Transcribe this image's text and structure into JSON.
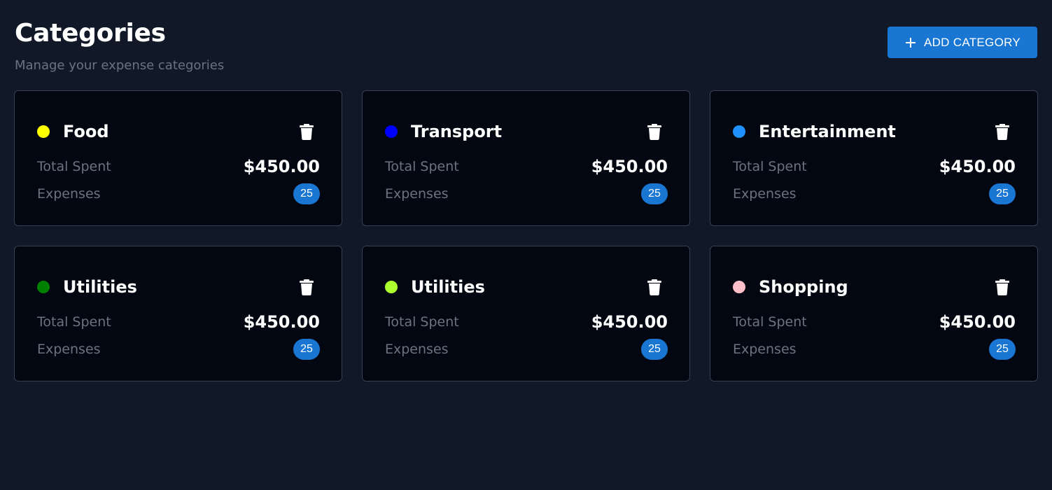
{
  "header": {
    "title": "Categories",
    "subtitle": "Manage your expense categories"
  },
  "toolbar": {
    "add_label": "ADD CATEGORY",
    "add_icon": "plus-icon",
    "accent_color": "#1976d2"
  },
  "labels": {
    "total_spent": "Total Spent",
    "expenses": "Expenses"
  },
  "categories": [
    {
      "name": "Food",
      "color": "#ffff00",
      "total": "$450.00",
      "count": "25"
    },
    {
      "name": "Transport",
      "color": "#0000ff",
      "total": "$450.00",
      "count": "25"
    },
    {
      "name": "Entertainment",
      "color": "#1e90ff",
      "total": "$450.00",
      "count": "25"
    },
    {
      "name": "Utilities",
      "color": "#008000",
      "total": "$450.00",
      "count": "25"
    },
    {
      "name": "Utilities",
      "color": "#adff2f",
      "total": "$450.00",
      "count": "25"
    },
    {
      "name": "Shopping",
      "color": "#ffc0cb",
      "total": "$450.00",
      "count": "25"
    }
  ],
  "card_icons": {
    "delete": "trash-icon"
  }
}
